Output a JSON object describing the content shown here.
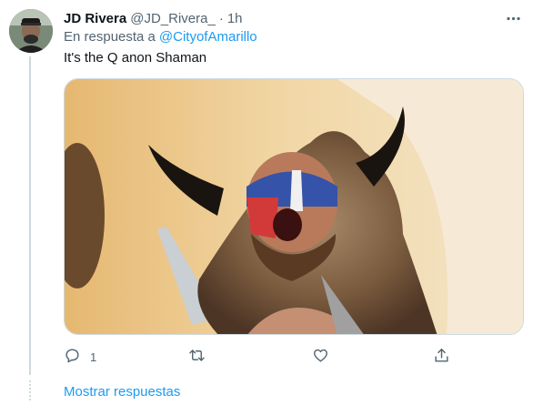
{
  "tweet": {
    "author_name": "JD Rivera",
    "author_handle": "@JD_Rivera_",
    "separator": "·",
    "time": "1h",
    "reply_prefix": "En respuesta a",
    "reply_to": "@CityofAmarillo",
    "text": "It's the Q anon Shaman",
    "media_description": "photo"
  },
  "actions": {
    "reply_count": "1",
    "retweet_count": "",
    "like_count": ""
  },
  "footer": {
    "show_replies_label": "Mostrar respuestas"
  },
  "icons": {
    "more": "more-dots-icon",
    "reply": "reply-bubble-icon",
    "retweet": "retweet-icon",
    "like": "heart-icon",
    "share": "share-upload-icon"
  },
  "colors": {
    "link": "#1d9bf0",
    "secondary_text": "#536471",
    "primary_text": "#0f1419",
    "thread_line": "#cfd9de"
  }
}
